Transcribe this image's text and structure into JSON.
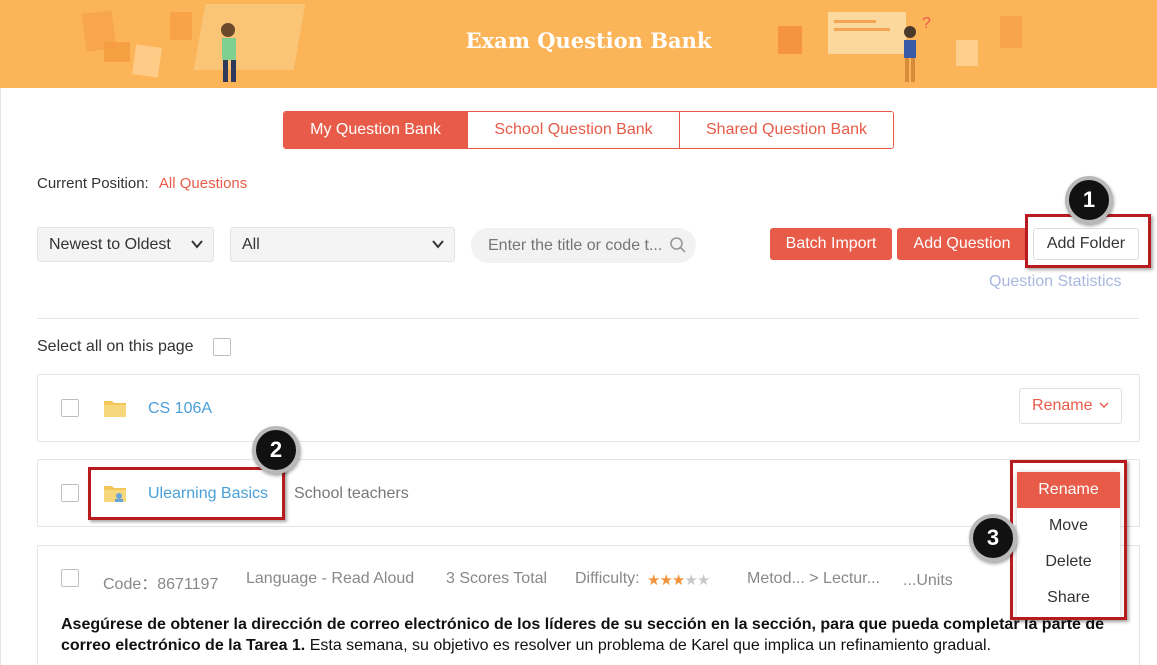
{
  "banner": {
    "title": "Exam Question Bank"
  },
  "tabs": [
    {
      "label": "My Question Bank",
      "active": true
    },
    {
      "label": "School Question Bank",
      "active": false
    },
    {
      "label": "Shared Question Bank",
      "active": false
    }
  ],
  "position": {
    "label": "Current Position:",
    "value": "All Questions"
  },
  "filters": {
    "sort": "Newest to Oldest",
    "type": "All",
    "search_placeholder": "Enter the title or code t..."
  },
  "actions": {
    "batch_import": "Batch Import",
    "add_question": "Add Question",
    "add_folder": "Add Folder",
    "statistics": "Question Statistics"
  },
  "select_all": "Select all on this page",
  "folders": [
    {
      "name": "CS 106A",
      "meta": "",
      "action": "Rename"
    },
    {
      "name": "Ulearning Basics",
      "meta": "School teachers"
    }
  ],
  "dropdown_menu": [
    "Rename",
    "Move",
    "Delete",
    "Share"
  ],
  "question": {
    "code": "Code：8671197",
    "type": "Language - Read Aloud",
    "scores": "3 Scores Total",
    "difficulty_label": "Difficulty:",
    "difficulty_rating": 3,
    "difficulty_max": 5,
    "path": "Metod... > Lectur...",
    "units": "...Units",
    "text_bold": "Asegúrese de obtener la dirección de correo electrónico de los líderes de su sección en la sección, para que pueda completar la parte de correo electrónico de la Tarea 1.",
    "text_normal": " Esta semana, su objetivo es resolver un problema de Karel que implica un refinamiento gradual."
  },
  "annotations": [
    "1",
    "2",
    "3"
  ],
  "colors": {
    "accent": "#e85b48",
    "banner": "#fbb458",
    "link": "#4a9fd8",
    "highlight": "#b81b1f"
  }
}
